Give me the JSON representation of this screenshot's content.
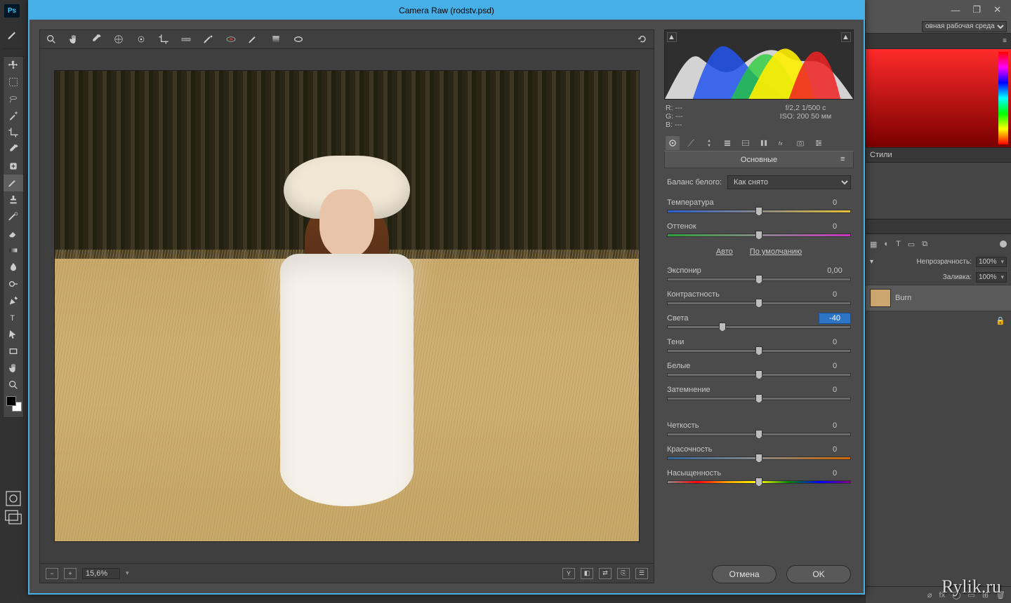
{
  "host_window": {
    "min": "—",
    "max": "❐",
    "close": "✕"
  },
  "ps": {
    "logo": "Ps",
    "workspace_label": "овная рабочая среда",
    "panels": {
      "styles": "Стили",
      "opacity_label": "Непрозрачность:",
      "opacity_value": "100%",
      "fill_label": "Заливка:",
      "fill_value": "100%",
      "layer_name": "Burn",
      "footer_fx": "fx"
    }
  },
  "cr": {
    "title": "Camera Raw (rodstv.psd)",
    "zoom": "15,6%",
    "meta": {
      "r": "R:   ---",
      "g": "G:   ---",
      "b": "B:   ---",
      "exposure_line": "f/2,2   1/500 c",
      "iso_line": "ISO: 200   50 мм"
    },
    "panel_title": "Основные",
    "wb": {
      "label": "Баланс белого:",
      "value": "Как снято"
    },
    "links": {
      "auto": "Авто",
      "default": "По умолчанию"
    },
    "sliders": {
      "temp": {
        "label": "Температура",
        "value": "0",
        "pos": 50
      },
      "tint": {
        "label": "Оттенок",
        "value": "0",
        "pos": 50
      },
      "expo": {
        "label": "Экспонир",
        "value": "0,00",
        "pos": 50
      },
      "contrast": {
        "label": "Контрастность",
        "value": "0",
        "pos": 50
      },
      "high": {
        "label": "Света",
        "value": "-40",
        "pos": 30
      },
      "shadow": {
        "label": "Тени",
        "value": "0",
        "pos": 50
      },
      "white": {
        "label": "Белые",
        "value": "0",
        "pos": 50
      },
      "black": {
        "label": "Затемнение",
        "value": "0",
        "pos": 50
      },
      "clarity": {
        "label": "Четкость",
        "value": "0",
        "pos": 50
      },
      "vib": {
        "label": "Красочность",
        "value": "0",
        "pos": 50
      },
      "sat": {
        "label": "Насыщенность",
        "value": "0",
        "pos": 50
      }
    },
    "buttons": {
      "cancel": "Отмена",
      "ok": "OK"
    },
    "footer_y": "Y"
  },
  "watermark": "Rylik.ru"
}
